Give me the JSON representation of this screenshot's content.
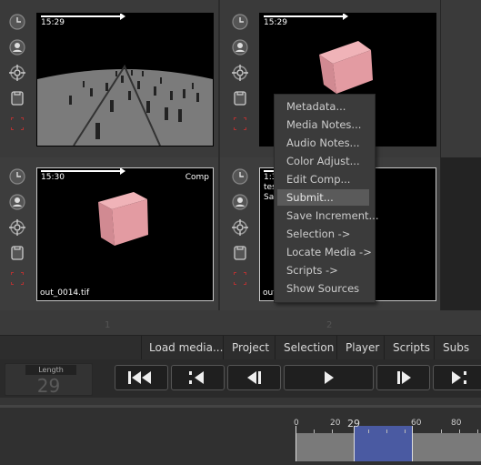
{
  "slots": [
    {
      "timecode": "15:29",
      "filename": "",
      "tag": "",
      "number": ""
    },
    {
      "timecode": "15:29",
      "filename": "",
      "tag": "",
      "number": ""
    },
    {
      "timecode": "15:30",
      "filename": "out_0014.tif",
      "tag": "Comp",
      "number": "1"
    },
    {
      "timecode": "1:3",
      "overlay_line2": "tes",
      "overlay_line3": "Sa",
      "filename": "out",
      "tag": "",
      "number": "2"
    }
  ],
  "icons": [
    "clock-icon",
    "person-icon",
    "target-icon",
    "document-icon",
    "expand-icon"
  ],
  "context_menu": {
    "items": [
      "Metadata...",
      "Media Notes...",
      "Audio Notes...",
      "Color Adjust...",
      "Edit Comp...",
      "Submit...",
      "Save Increment...",
      "Selection ->",
      "Locate Media ->",
      "Scripts ->",
      "Show Sources"
    ],
    "highlighted": "Submit..."
  },
  "menubar": {
    "items": [
      "Load media...",
      "Project",
      "Selection",
      "Player",
      "Scripts",
      "Subs"
    ]
  },
  "length": {
    "label": "Length",
    "value": "29"
  },
  "transport": [
    "skip-to-start-icon",
    "step-back-icon",
    "frame-back-icon",
    "play-icon",
    "frame-forward-icon",
    "step-forward-icon"
  ],
  "timeline": {
    "labels": [
      "0",
      "20",
      "29",
      "60",
      "80"
    ],
    "current_frame": 29,
    "selection_start": 29,
    "selection_end": 60,
    "colors": {
      "selection": "#4a5aa2",
      "track": "#7a7a7a"
    }
  }
}
